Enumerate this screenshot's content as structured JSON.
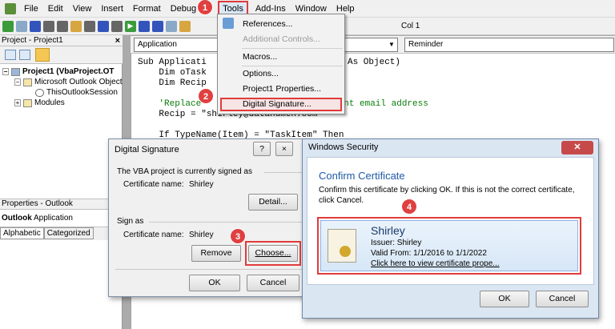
{
  "menu": [
    "File",
    "Edit",
    "View",
    "Insert",
    "Format",
    "Debug",
    "Tools",
    "Add-Ins",
    "Window",
    "Help"
  ],
  "toolbar": {
    "position": "Col 1"
  },
  "project": {
    "title": "Project - Project1",
    "close": "×",
    "tree": [
      "Project1 (VbaProject.OT",
      "Microsoft Outlook Object",
      "ThisOutlookSession",
      "Modules"
    ]
  },
  "properties": {
    "title": "Properties - Outlook",
    "object_bold": "Outlook",
    "object_type": "Application",
    "tabs": [
      "Alphabetic",
      "Categorized"
    ]
  },
  "code": {
    "object_combo": "Application",
    "proc_combo": "Reminder",
    "lines": [
      "Sub Applicati",
      "As Object)",
      "    Dim oTask",
      "    Dim Recip",
      "    'Replace",
      "ient email address",
      "    Recip = \"shirley@datanumen.com\"",
      "    If TypeName(Item) = \"TaskItem\" Then"
    ]
  },
  "tools_menu": {
    "items": [
      "References...",
      "Additional Controls...",
      "Macros...",
      "Options...",
      "Project1 Properties...",
      "Digital Signature..."
    ]
  },
  "badges": [
    "1",
    "2",
    "3",
    "4"
  ],
  "digsig": {
    "title": "Digital Signature",
    "help": "?",
    "close": "×",
    "signed_as": "The VBA project is currently signed as",
    "cert_label": "Certificate name:",
    "cert_name": "Shirley",
    "detail": "Detail...",
    "sign_as": "Sign as",
    "cert_label2": "Certificate name:",
    "cert_name2": "Shirley",
    "remove": "Remove",
    "choose": "Choose...",
    "ok": "OK",
    "cancel": "Cancel"
  },
  "winsec": {
    "title": "Windows Security",
    "close": "✕",
    "heading": "Confirm Certificate",
    "desc": "Confirm this certificate by clicking OK. If this is not the correct certificate, click Cancel.",
    "cert_name": "Shirley",
    "issuer": "Issuer: Shirley",
    "valid": "Valid From: 1/1/2016 to 1/1/2022",
    "link": "Click here to view certificate prope...",
    "ok": "OK",
    "cancel": "Cancel",
    "accent": "#1e5aa8"
  }
}
